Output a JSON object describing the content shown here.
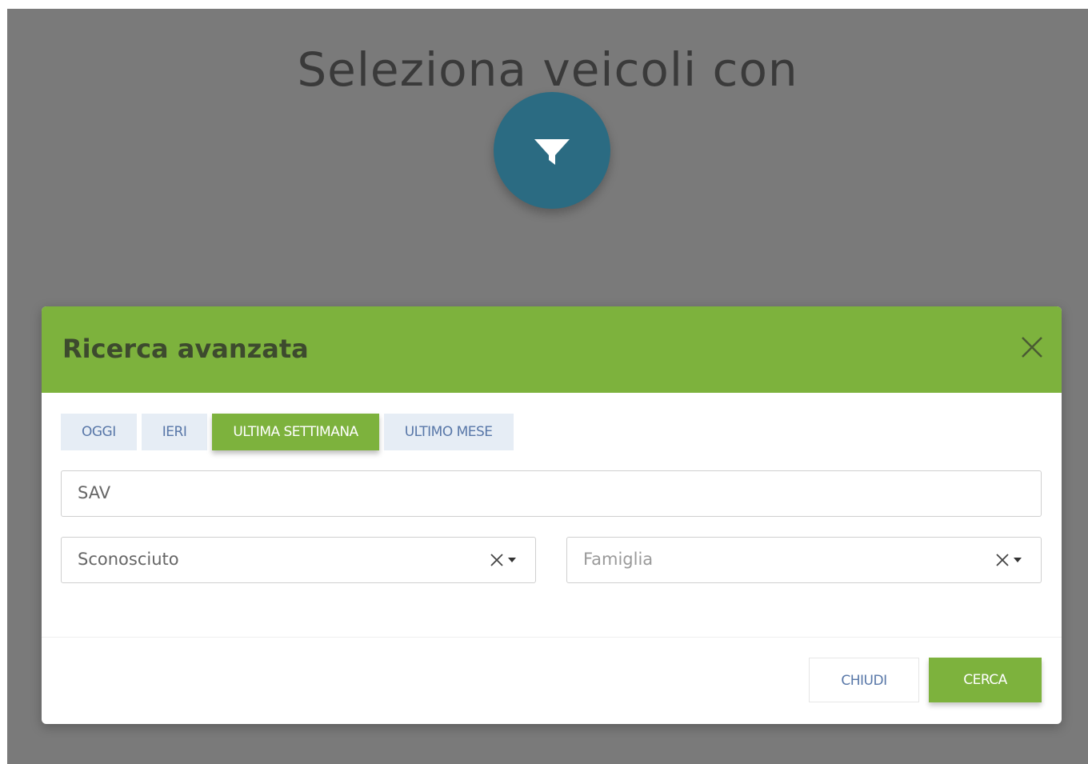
{
  "background": {
    "title": "Seleziona veicoli con",
    "filter_icon": "filter-funnel-icon"
  },
  "modal": {
    "title": "Ricerca avanzata",
    "close_icon": "close-icon",
    "tabs": [
      {
        "label": "OGGI",
        "active": false
      },
      {
        "label": "IERI",
        "active": false
      },
      {
        "label": "ULTIMA SETTIMANA",
        "active": true
      },
      {
        "label": "ULTIMO MESE",
        "active": false
      }
    ],
    "text_field": {
      "value": "SAV"
    },
    "select_status": {
      "value": "Sconosciuto"
    },
    "select_family": {
      "placeholder": "Famiglia"
    },
    "buttons": {
      "close_label": "CHIUDI",
      "search_label": "CERCA"
    }
  },
  "colors": {
    "accent_green": "#7db23d",
    "fab_teal": "#2b6b82",
    "tab_bg": "#e6edf5",
    "tab_text": "#5877a8",
    "overlay": "#7a7a7a"
  }
}
